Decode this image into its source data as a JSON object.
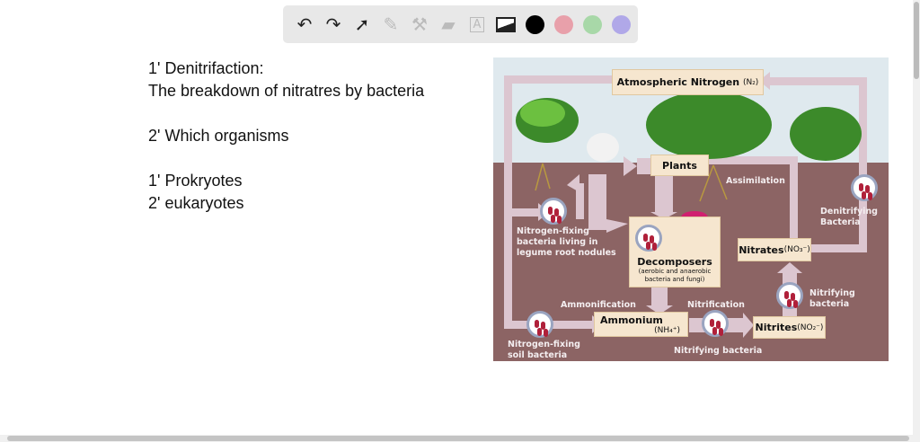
{
  "toolbar": {
    "tools": [
      "undo-icon",
      "redo-icon",
      "pointer-icon",
      "pencil-icon",
      "tools-icon",
      "eraser-icon",
      "text-icon",
      "image-icon"
    ],
    "colors": [
      "#000000",
      "#e8a0aa",
      "#a8d8a8",
      "#b0a8e8"
    ]
  },
  "notes": {
    "lines": [
      "1' Denitrifaction:",
      "The breakdown of nitratres by bacteria",
      "",
      "2' Which organisms",
      "",
      "1' Prokryotes",
      "2' eukaryotes"
    ]
  },
  "diagram": {
    "atmospheric": "Atmospheric Nitrogen",
    "atmospheric_formula": "(N₂)",
    "plants": "Plants",
    "assimilation": "Assimilation",
    "denitrifying": "Denitrifying Bacteria",
    "legume": "Nitrogen-fixing bacteria living in legume root nodules",
    "decomposers": "Decomposers",
    "decomposers_sub": "(aerobic and anaerobic bacteria and fungi)",
    "nitrates": "Nitrates",
    "nitrates_formula": "(NO₃⁻)",
    "nitrifying_right": "Nitrifying bacteria",
    "ammonification": "Ammonification",
    "nitrification": "Nitrification",
    "ammonium": "Ammonium",
    "ammonium_formula": "(NH₄⁺)",
    "nitrites": "Nitrites",
    "nitrites_formula": "(NO₂⁻)",
    "soil": "Nitrogen-fixing soil bacteria",
    "nitrifying_bottom": "Nitrifying bacteria"
  }
}
